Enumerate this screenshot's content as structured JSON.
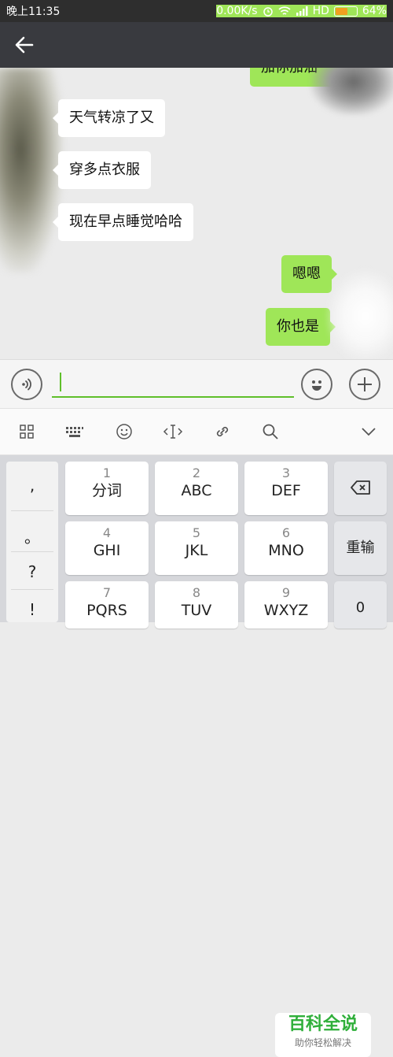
{
  "status": {
    "time": "晚上11:35",
    "speed": "0.00K/s",
    "network": "HD",
    "battery": "64%",
    "battery_level": 0.64
  },
  "chat": {
    "messages": [
      {
        "side": "right",
        "text": "加你加油"
      },
      {
        "side": "left",
        "text": "天气转凉了又"
      },
      {
        "side": "left",
        "text": "穿多点衣服"
      },
      {
        "side": "left",
        "text": "现在早点睡觉哈哈"
      },
      {
        "side": "right",
        "text": "嗯嗯"
      },
      {
        "side": "right",
        "text": "你也是"
      }
    ]
  },
  "input": {
    "value": ""
  },
  "keyboard": {
    "left_column": [
      ",",
      "。",
      "?",
      "!"
    ],
    "keys": [
      {
        "num": "1",
        "label": "分词"
      },
      {
        "num": "2",
        "label": "ABC"
      },
      {
        "num": "3",
        "label": "DEF"
      },
      {
        "num": "4",
        "label": "GHI"
      },
      {
        "num": "5",
        "label": "JKL"
      },
      {
        "num": "6",
        "label": "MNO"
      },
      {
        "num": "7",
        "label": "PQRS"
      },
      {
        "num": "8",
        "label": "TUV"
      },
      {
        "num": "9",
        "label": "WXYZ"
      }
    ],
    "reenter_label": "重输",
    "zero_label": "0"
  },
  "watermark": {
    "title": "百科全说",
    "subtitle": "助你轻松解决"
  },
  "colors": {
    "accent": "#5fbf2a",
    "bubble_out": "#9fe658",
    "topbar": "#393a3f"
  }
}
